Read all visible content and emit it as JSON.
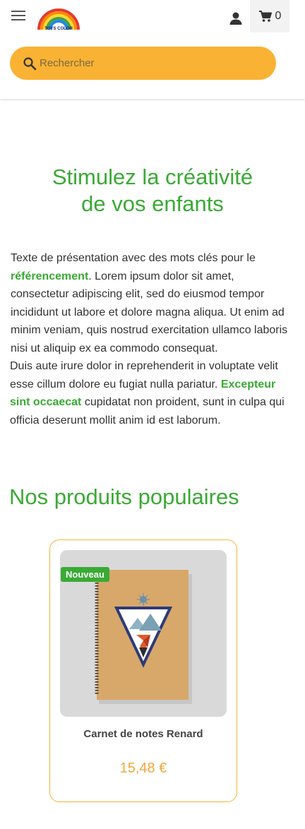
{
  "header": {
    "logo_text": "TOYS COLOR",
    "cart_count": "0",
    "search": {
      "placeholder": "Rechercher"
    }
  },
  "hero": {
    "title_line1": "Stimulez la créativité",
    "title_line2": "de vos enfants"
  },
  "intro": {
    "p1_a": "Texte de présentation avec des mots clés pour le ",
    "p1_highlight": "référencement",
    "p1_b": ". Lorem ipsum dolor sit amet, consectetur adipiscing elit, sed do eiusmod tempor incididunt ut labore et dolore magna aliqua. Ut enim ad minim veniam, quis nostrud exercitation ullamco laboris nisi ut aliquip ex ea commodo consequat.",
    "p2_a": "Duis aute irure dolor in reprehenderit in voluptate velit esse cillum dolore eu fugiat nulla pariatur. ",
    "p2_highlight": "Excepteur sint occaecat",
    "p2_b": " cupidatat non proident, sunt in culpa qui officia deserunt mollit anim id est laborum."
  },
  "products": {
    "section_title": "Nos produits populaires",
    "items": [
      {
        "badge": "Nouveau",
        "name": "Carnet de notes Renard",
        "price": "15,48 €"
      }
    ]
  },
  "colors": {
    "brand_green": "#3aaa35",
    "search_yellow": "#f9b233",
    "price_orange": "#f2a83a"
  }
}
